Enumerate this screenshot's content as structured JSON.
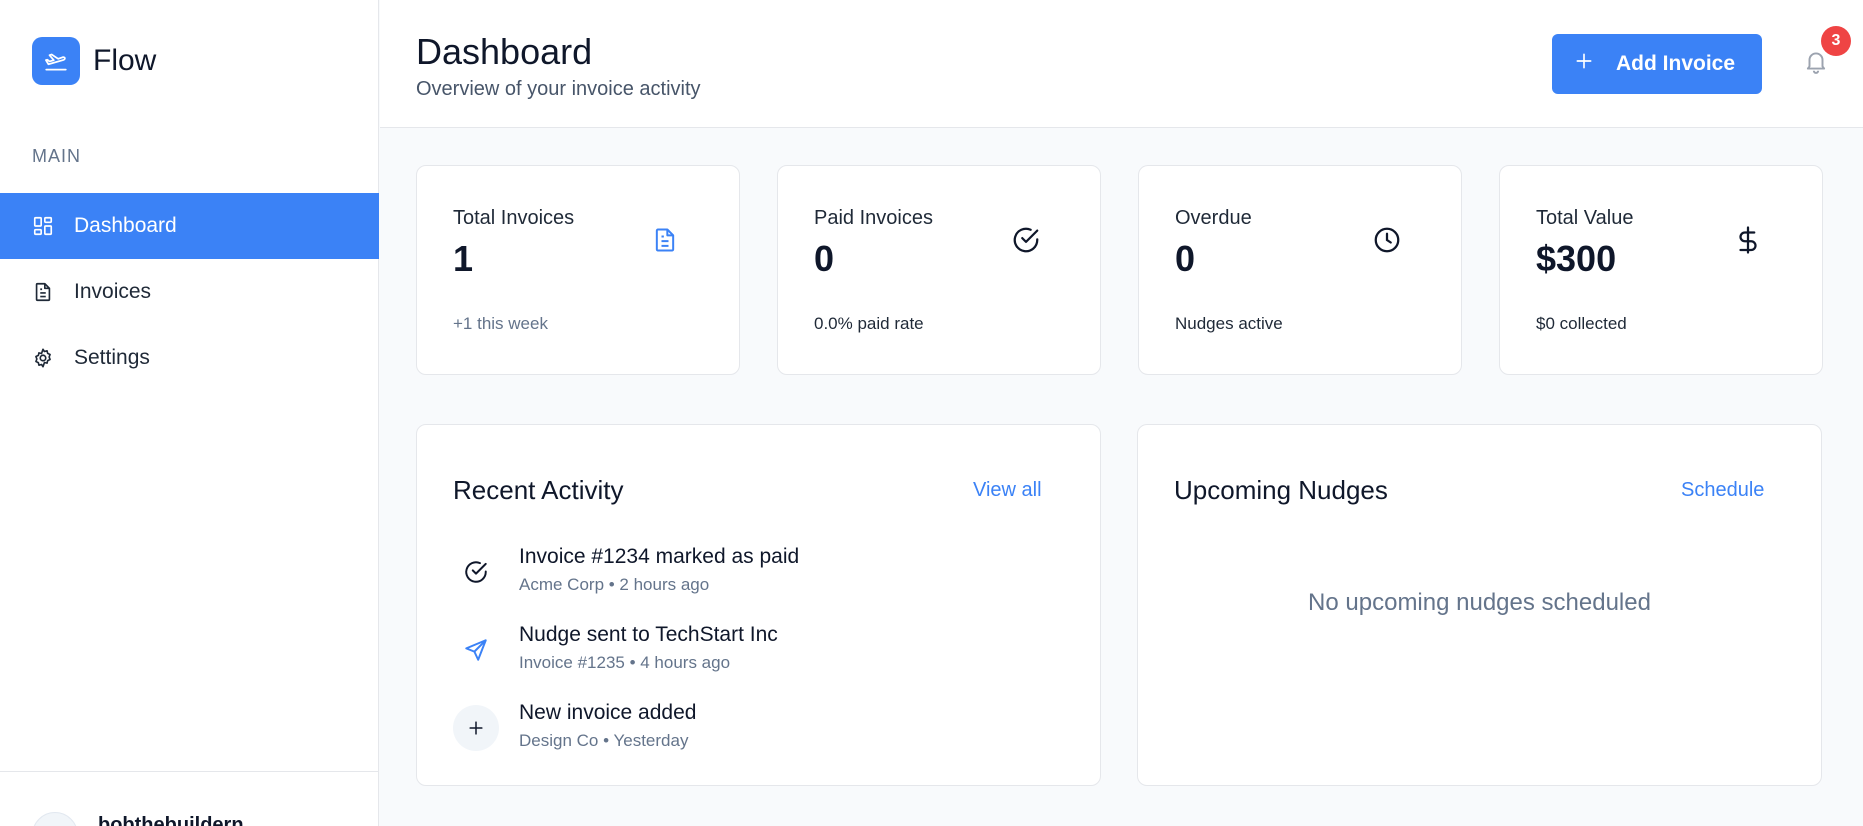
{
  "brand": {
    "name": "Flow"
  },
  "sidebar": {
    "section_label": "MAIN",
    "items": [
      {
        "label": "Dashboard",
        "icon": "dashboard-grid-icon",
        "active": true
      },
      {
        "label": "Invoices",
        "icon": "document-icon",
        "active": false
      },
      {
        "label": "Settings",
        "icon": "gear-icon",
        "active": false
      }
    ],
    "user_name": "bobthebuildern"
  },
  "header": {
    "title": "Dashboard",
    "subtitle": "Overview of your invoice activity",
    "add_button_label": "Add Invoice",
    "notification_count": "3"
  },
  "stats": [
    {
      "label": "Total Invoices",
      "value": "1",
      "note": "+1 this week",
      "icon": "document-icon"
    },
    {
      "label": "Paid Invoices",
      "value": "0",
      "note": "0.0% paid rate",
      "icon": "check-circle-icon"
    },
    {
      "label": "Overdue",
      "value": "0",
      "note": "Nudges active",
      "icon": "clock-icon"
    },
    {
      "label": "Total Value",
      "value": "$300",
      "note": "$0 collected",
      "icon": "dollar-icon"
    }
  ],
  "recent_activity": {
    "title": "Recent Activity",
    "link_label": "View all",
    "items": [
      {
        "title": "Invoice #1234 marked as paid",
        "subtitle": "Acme Corp • 2 hours ago",
        "icon": "check-circle-icon"
      },
      {
        "title": "Nudge sent to TechStart Inc",
        "subtitle": "Invoice #1235 • 4 hours ago",
        "icon": "send-icon"
      },
      {
        "title": "New invoice added",
        "subtitle": "Design Co • Yesterday",
        "icon": "plus-icon"
      }
    ]
  },
  "upcoming_nudges": {
    "title": "Upcoming Nudges",
    "link_label": "Schedule",
    "empty_text": "No upcoming nudges scheduled"
  },
  "colors": {
    "accent": "#3b82f6",
    "badge": "#ef4444",
    "text": "#0f172a",
    "muted": "#64748b",
    "border": "#e5e7eb"
  }
}
